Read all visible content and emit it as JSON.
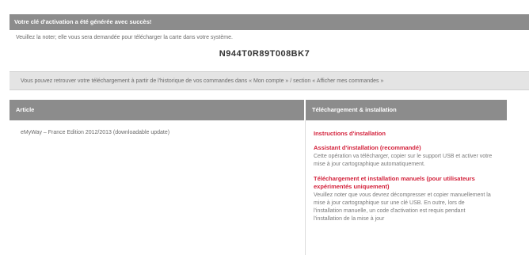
{
  "success_message": "Votre clé d'activation a été générée avec succès!",
  "note": "Veuillez la noter; elle vous sera demandée pour télécharger la carte dans votre système.",
  "activation_code": "N944T0R89T008BK7",
  "info_message": "Vous pouvez retrouver votre téléchargement à partir de l'historique de vos commandes dans « Mon compte » / section « Afficher mes commandes »",
  "table": {
    "headers": {
      "article": "Article",
      "download": "Téléchargement & installation"
    },
    "article_name": "eMyWay – France Edition 2012/2013 (downloadable update)",
    "links": {
      "instructions": "Instructions d'installation",
      "assistant_title": "Assistant d'installation (recommandé)",
      "assistant_desc": "Cette opération va télécharger, copier sur le support USB et activer votre mise à jour cartographique automatiquement.",
      "manual_title": "Téléchargement et installation manuels (pour utilisateurs expérimentés uniquement)",
      "manual_desc": "Veuillez noter que vous devrez décompresser et copier manuellement la mise à jour cartographique sur une clé USB. En outre, lors de l'installation manuelle, un code d'activation est requis pendant l'installation de la mise à jour"
    }
  }
}
